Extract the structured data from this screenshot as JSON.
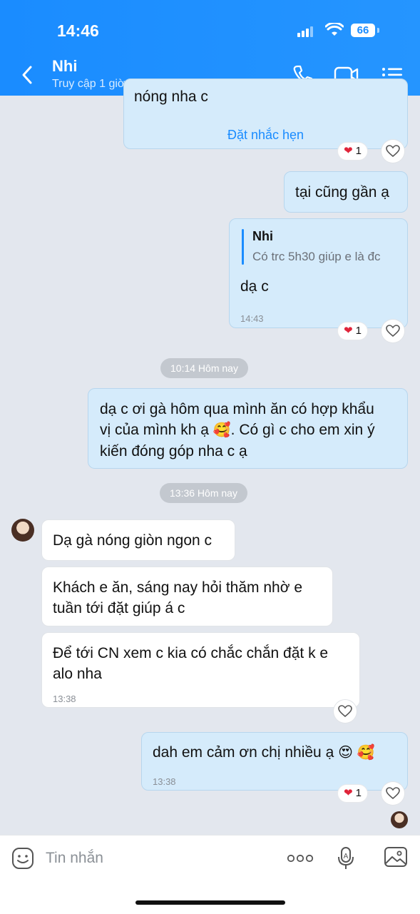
{
  "status_bar": {
    "time": "14:46",
    "battery": "66"
  },
  "header": {
    "name": "Nhi",
    "status": "Truy cập 1 giờ trước"
  },
  "messages": {
    "m1": {
      "partial_text": "nóng nha c",
      "link": "Đặt nhắc hẹn",
      "reaction_count": "1"
    },
    "m2": {
      "text": "tại cũng gần ạ"
    },
    "m3": {
      "quote_author": "Nhi",
      "quote_text": "Có trc 5h30 giúp e là đc",
      "text": "dạ c",
      "time": "14:43",
      "reaction_count": "1"
    },
    "date1": "10:14 Hôm nay",
    "m4": {
      "line1": "dạ c ơi gà hôm qua mình ăn có hợp khẩu",
      "line2": "vị của mình kh ạ",
      "line2_after": ". Có gì c cho em xin ý",
      "line3": "kiến đóng góp nha c ạ"
    },
    "date2": "13:36 Hôm nay",
    "m5": {
      "text": "Dạ gà nóng giòn ngon c"
    },
    "m6": {
      "line1": "Khách e ăn, sáng nay hỏi thăm nhờ e",
      "line2": "tuần tới đặt giúp á c"
    },
    "m7": {
      "line1": "Để tới CN xem c kia có chắc chắn đặt k e",
      "line2": "alo nha",
      "time": "13:38"
    },
    "m8": {
      "text": "dah em cảm ơn chị nhiều ạ",
      "time": "13:38",
      "reaction_count": "1"
    }
  },
  "input": {
    "placeholder": "Tin nhắn"
  },
  "colors": {
    "header": "#1a8cff",
    "outgoing_bubble": "#d5ebfb",
    "incoming_bubble": "#ffffff",
    "link": "#1a8cff",
    "heart": "#e0243a"
  }
}
